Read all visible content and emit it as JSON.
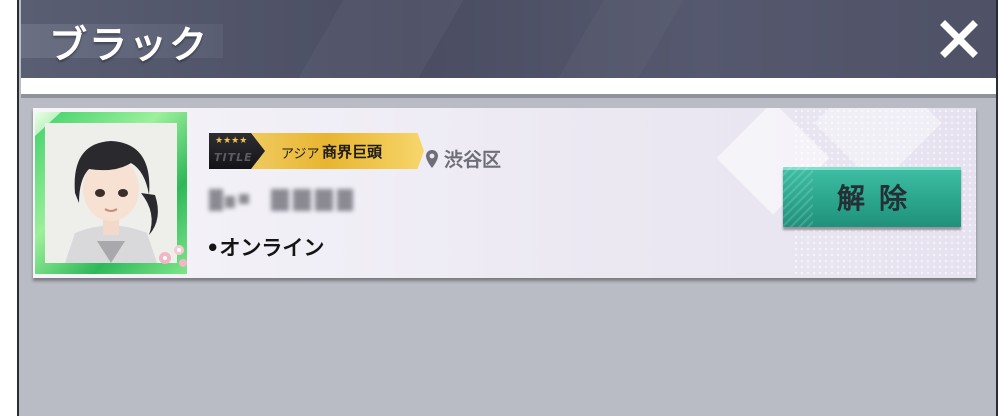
{
  "header": {
    "title": "ブラック",
    "close_icon": "close-icon"
  },
  "blocked_user": {
    "title_badge": {
      "stars": "★★★★",
      "badge_word": "TITLE",
      "region": "アジア",
      "name": "商界巨頭"
    },
    "location": {
      "icon": "location-pin-icon",
      "text": "渋谷区"
    },
    "status": "•オンライン",
    "unblock_button_label": "解除"
  },
  "colors": {
    "header_bg": "#4f5267",
    "button_teal": "#2ba68d",
    "badge_gold": "#e8b532",
    "avatar_frame_green": "#3fd06a",
    "panel_bg": "#b9bcc4"
  }
}
